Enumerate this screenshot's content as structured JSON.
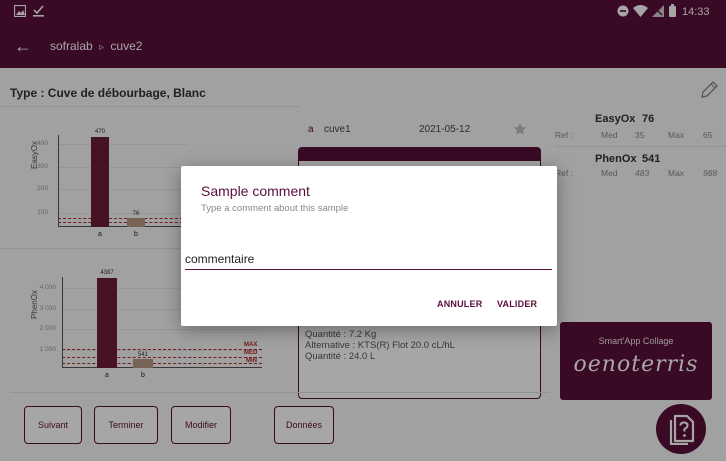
{
  "status": {
    "time": "14:33"
  },
  "appbar": {
    "crumb_root": "sofralab",
    "crumb_sep": "▹",
    "crumb_leaf": "cuve2"
  },
  "page": {
    "type_title": "Type : Cuve de débourbage, Blanc"
  },
  "chart_data": [
    {
      "type": "bar",
      "ylabel": "EasyOx",
      "ylim": [
        0,
        450
      ],
      "yticks": [
        "400",
        "300",
        "200",
        "100"
      ],
      "categories": [
        "a",
        "b"
      ],
      "values": [
        470,
        76
      ],
      "value_labels": [
        "470",
        "76"
      ],
      "ref_lines": {
        "min": 35,
        "max": 65
      }
    },
    {
      "type": "bar",
      "ylabel": "PhenOx",
      "ylim": [
        0,
        4500
      ],
      "yticks": [
        "4 000",
        "3 000",
        "2 000",
        "1 000"
      ],
      "categories": [
        "a",
        "b"
      ],
      "values": [
        4387,
        541
      ],
      "value_labels": [
        "4387",
        "541"
      ],
      "ref_labels": [
        "MAX",
        "MED",
        "MIN"
      ],
      "ref_lines": {
        "min": 483,
        "max": 988
      }
    }
  ],
  "sample": {
    "letter": "a",
    "name": "cuve1",
    "date": "2021-05-12"
  },
  "detail": {
    "quantity1": "Quantité : 7.2 Kg",
    "alternative": "Alternative : KTS(R) Flot 20.0 cL/hL",
    "quantity2": "Quantité : 24.0 L"
  },
  "params": [
    {
      "name": "EasyOx",
      "value": "76",
      "ref_label": "Ref :",
      "med_label": "Med",
      "med": "35",
      "max_label": "Max",
      "max": "65"
    },
    {
      "name": "PhenOx",
      "value": "541",
      "ref_label": "Ref :",
      "med_label": "Med",
      "med": "483",
      "max_label": "Max",
      "max": "988"
    }
  ],
  "brand": {
    "tagline": "Smart'App Collage",
    "logo_text": "oenoterris"
  },
  "buttons": {
    "next": "Suivant",
    "finish": "Terminer",
    "modify": "Modifier",
    "data": "Données"
  },
  "dialog": {
    "title": "Sample comment",
    "subtitle": "Type a comment about this sample",
    "input_value": "commentaire",
    "cancel": "ANNULER",
    "confirm": "VALIDER"
  },
  "colors": {
    "primary": "#5a0f3a",
    "bar_a": "#6a1e36",
    "bar_b": "#b99a86",
    "ref_line": "#b22a2a"
  }
}
